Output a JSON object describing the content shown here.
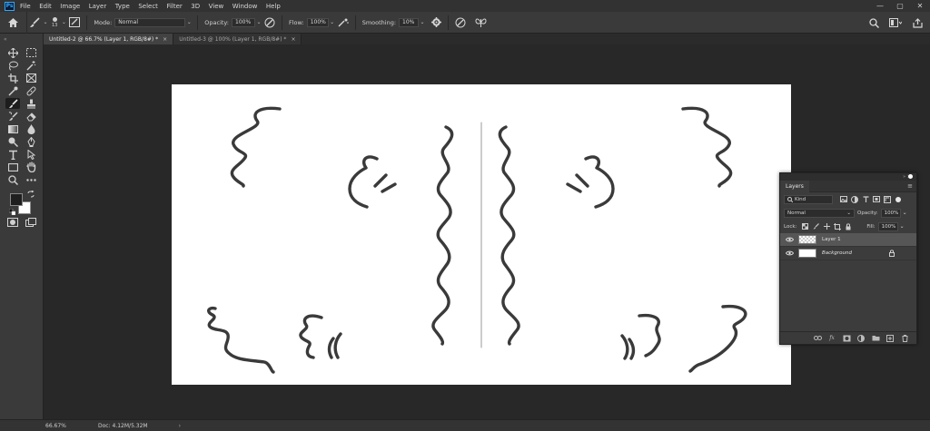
{
  "app": {
    "logo": "Ps"
  },
  "menu": [
    "File",
    "Edit",
    "Image",
    "Layer",
    "Type",
    "Select",
    "Filter",
    "3D",
    "View",
    "Window",
    "Help"
  ],
  "window_controls": {
    "minimize": "—",
    "maximize": "▢",
    "close": "✕"
  },
  "options": {
    "brush_size": "13",
    "mode_label": "Mode:",
    "mode_value": "Normal",
    "opacity_label": "Opacity:",
    "opacity_value": "100%",
    "flow_label": "Flow:",
    "flow_value": "100%",
    "smoothing_label": "Smoothing:",
    "smoothing_value": "10%"
  },
  "tabs": [
    {
      "label": "Untitled-2 @ 66.7% (Layer 1, RGB/8#) *",
      "active": true
    },
    {
      "label": "Untitled-3 @ 100% (Layer 1, RGB/8#) *",
      "active": false
    }
  ],
  "tab_close": "×",
  "toolbar": {
    "grip": "«"
  },
  "layers_panel": {
    "top_controls": "» ✕",
    "tab": "Layers",
    "menu_icon": "≡",
    "filter_label": "Kind",
    "blend_mode": "Normal",
    "opacity_label": "Opacity:",
    "opacity_value": "100%",
    "lock_label": "Lock:",
    "fill_label": "Fill:",
    "fill_value": "100%",
    "layers": [
      {
        "name": "Layer 1",
        "selected": true,
        "italic": false
      },
      {
        "name": "Background",
        "selected": false,
        "italic": true
      }
    ],
    "bottom_icons": [
      "link-icon",
      "fx-icon",
      "mask-icon",
      "adjustment-icon",
      "group-icon",
      "new-layer-icon",
      "trash-icon"
    ],
    "fx_label": "fx"
  },
  "status": {
    "zoom": "66.67%",
    "doc": "Doc: 4.12M/5.32M",
    "arrow": "›"
  },
  "colors": {
    "foreground": "#1f1f1f",
    "background": "#ffffff",
    "stroke": "#3a3a3a"
  }
}
